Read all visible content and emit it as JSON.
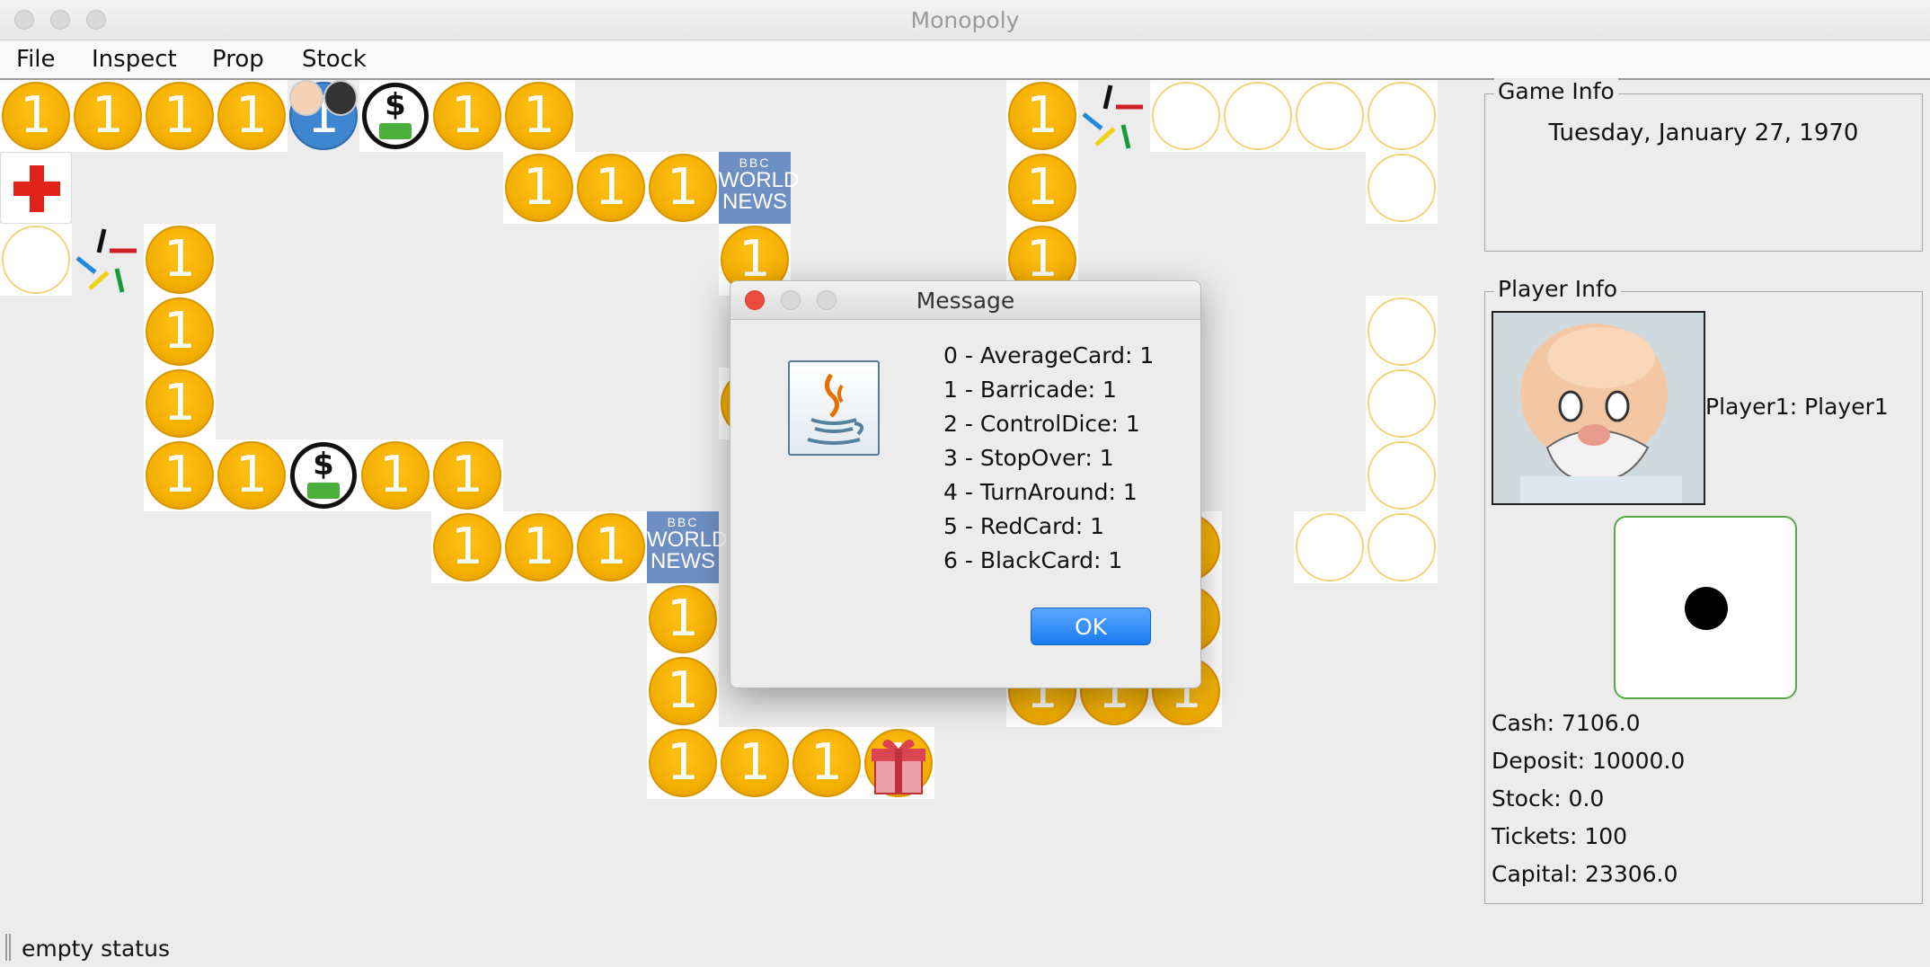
{
  "window": {
    "title": "Monopoly"
  },
  "menu": [
    "File",
    "Inspect",
    "Prop",
    "Stock"
  ],
  "board": {
    "coin_label": "1",
    "news_tile": {
      "top": "BBC",
      "mid": "WORLD",
      "bottom": "NEWS"
    },
    "bank_symbol": "$"
  },
  "dialog": {
    "title": "Message",
    "lines": [
      "0 - AverageCard: 1",
      "1 - Barricade: 1",
      "2 - ControlDice: 1",
      "3 - StopOver: 1",
      "4 - TurnAround: 1",
      "5 - RedCard: 1",
      "6 - BlackCard: 1"
    ],
    "ok_label": "OK"
  },
  "game_info": {
    "legend": "Game Info",
    "date": "Tuesday, January 27, 1970"
  },
  "player_info": {
    "legend": "Player Info",
    "player_label": "Player1: Player1",
    "dice_value": 1,
    "cash": "Cash: 7106.0",
    "deposit": "Deposit: 10000.0",
    "stock": "Stock: 0.0",
    "tickets": "Tickets: 100",
    "capital": "Capital: 23306.0"
  },
  "status": {
    "text": "empty status"
  },
  "colors": {
    "coin": "#f5b000",
    "news": "#6e8fc3",
    "ok_button": "#1a7cf2",
    "close": "#ee4b3f"
  }
}
